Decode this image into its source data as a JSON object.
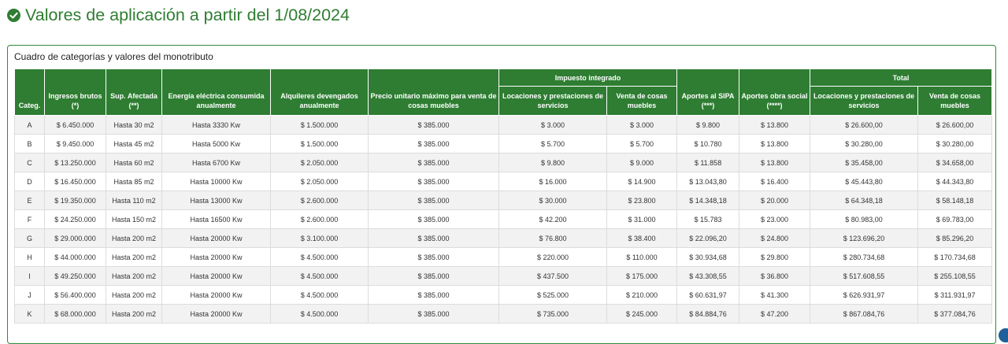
{
  "colors": {
    "accent": "#2e7d32",
    "title": "#2f7d32"
  },
  "title": "Valores de aplicación a partir del 1/08/2024",
  "title_icon": "check-circle-icon",
  "caption": "Cuadro de categorías y valores del monotributo",
  "headers": {
    "categ": "Categ.",
    "ingresos": "Ingresos brutos (*)",
    "sup": "Sup. Afectada (**)",
    "energia": "Energía eléctrica consumida anualmente",
    "alquileres": "Alquileres devengados anualmente",
    "precio": "Precio unitario máximo para venta de cosas muebles",
    "impuesto_group": "Impuesto integrado",
    "imp_locaciones": "Locaciones y prestaciones de servicios",
    "imp_venta": "Venta de cosas muebles",
    "sipa": "Aportes al SIPA (***)",
    "obra": "Aportes obra social (****)",
    "total_group": "Total",
    "tot_locaciones": "Locaciones y prestaciones de servicios",
    "tot_venta": "Venta de cosas muebles"
  },
  "rows": [
    [
      "A",
      "$ 6.450.000",
      "Hasta 30 m2",
      "Hasta 3330 Kw",
      "$ 1.500.000",
      "$ 385.000",
      "$ 3.000",
      "$ 3.000",
      "$ 9.800",
      "$ 13.800",
      "$ 26.600,00",
      "$ 26.600,00"
    ],
    [
      "B",
      "$ 9.450.000",
      "Hasta 45 m2",
      "Hasta 5000 Kw",
      "$ 1.500.000",
      "$ 385.000",
      "$ 5.700",
      "$ 5.700",
      "$ 10.780",
      "$ 13.800",
      "$ 30.280,00",
      "$ 30.280,00"
    ],
    [
      "C",
      "$ 13.250.000",
      "Hasta 60 m2",
      "Hasta 6700 Kw",
      "$ 2.050.000",
      "$ 385.000",
      "$ 9.800",
      "$ 9.000",
      "$ 11.858",
      "$ 13.800",
      "$ 35.458,00",
      "$ 34.658,00"
    ],
    [
      "D",
      "$ 16.450.000",
      "Hasta 85 m2",
      "Hasta 10000 Kw",
      "$ 2.050.000",
      "$ 385.000",
      "$ 16.000",
      "$ 14.900",
      "$ 13.043,80",
      "$ 16.400",
      "$ 45.443,80",
      "$ 44.343,80"
    ],
    [
      "E",
      "$ 19.350.000",
      "Hasta 110 m2",
      "Hasta 13000 Kw",
      "$ 2.600.000",
      "$ 385.000",
      "$ 30.000",
      "$ 23.800",
      "$ 14.348,18",
      "$ 20.000",
      "$ 64.348,18",
      "$ 58.148,18"
    ],
    [
      "F",
      "$ 24.250.000",
      "Hasta 150 m2",
      "Hasta 16500 Kw",
      "$ 2.600.000",
      "$ 385.000",
      "$ 42.200",
      "$ 31.000",
      "$ 15.783",
      "$ 23.000",
      "$ 80.983,00",
      "$ 69.783,00"
    ],
    [
      "G",
      "$ 29.000.000",
      "Hasta 200 m2",
      "Hasta 20000 Kw",
      "$ 3.100.000",
      "$ 385.000",
      "$ 76.800",
      "$ 38.400",
      "$ 22.096,20",
      "$ 24.800",
      "$ 123.696,20",
      "$ 85.296,20"
    ],
    [
      "H",
      "$ 44.000.000",
      "Hasta 200 m2",
      "Hasta 20000 Kw",
      "$ 4.500.000",
      "$ 385.000",
      "$ 220.000",
      "$ 110.000",
      "$ 30.934,68",
      "$ 29.800",
      "$ 280.734,68",
      "$ 170.734,68"
    ],
    [
      "I",
      "$ 49.250.000",
      "Hasta 200 m2",
      "Hasta 20000 Kw",
      "$ 4.500.000",
      "$ 385.000",
      "$ 437.500",
      "$ 175.000",
      "$ 43.308,55",
      "$ 36.800",
      "$ 517.608,55",
      "$ 255.108,55"
    ],
    [
      "J",
      "$ 56.400.000",
      "Hasta 200 m2",
      "Hasta 20000 Kw",
      "$ 4.500.000",
      "$ 385.000",
      "$ 525.000",
      "$ 210.000",
      "$ 60.631,97",
      "$ 41.300",
      "$ 626.931,97",
      "$ 311.931,97"
    ],
    [
      "K",
      "$ 68.000.000",
      "Hasta 200 m2",
      "Hasta 20000 Kw",
      "$ 4.500.000",
      "$ 385.000",
      "$ 735.000",
      "$ 245.000",
      "$ 84.884,76",
      "$ 47.200",
      "$ 867.084,76",
      "$ 377.084,76"
    ]
  ]
}
